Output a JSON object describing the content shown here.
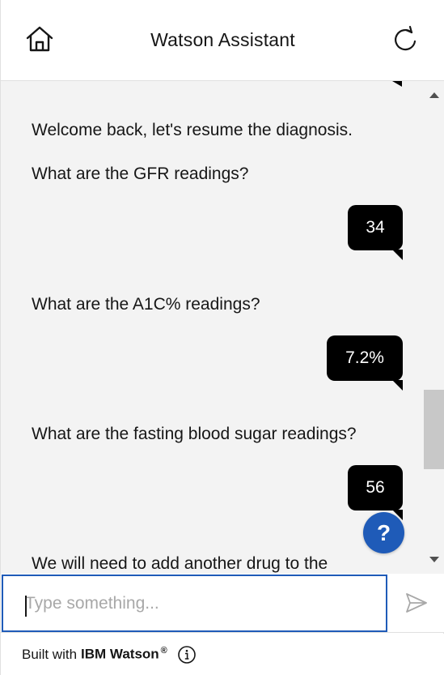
{
  "header": {
    "title": "Watson Assistant",
    "home_icon": "home-icon",
    "restart_icon": "restart-icon"
  },
  "conversation": {
    "messages": [
      {
        "from": "bot",
        "text": "Welcome back, let's resume the diagnosis."
      },
      {
        "from": "bot",
        "text": "What are the GFR readings?"
      },
      {
        "from": "user",
        "text": "34"
      },
      {
        "from": "bot",
        "text": "What are the A1C% readings?"
      },
      {
        "from": "user",
        "text": "7.2%"
      },
      {
        "from": "bot",
        "text": "What are the fasting blood sugar readings?"
      },
      {
        "from": "user",
        "text": "56"
      },
      {
        "from": "bot",
        "text": "We will need to add another drug to the"
      }
    ]
  },
  "help_button": {
    "label": "?"
  },
  "input": {
    "placeholder": "Type something...",
    "value": ""
  },
  "footer": {
    "prefix": "Built with",
    "brand": "IBM Watson",
    "registered_mark": "®"
  },
  "colors": {
    "accent": "#1f5bb8",
    "user_bubble": "#000000",
    "message_area_bg": "#f3f3f3"
  }
}
